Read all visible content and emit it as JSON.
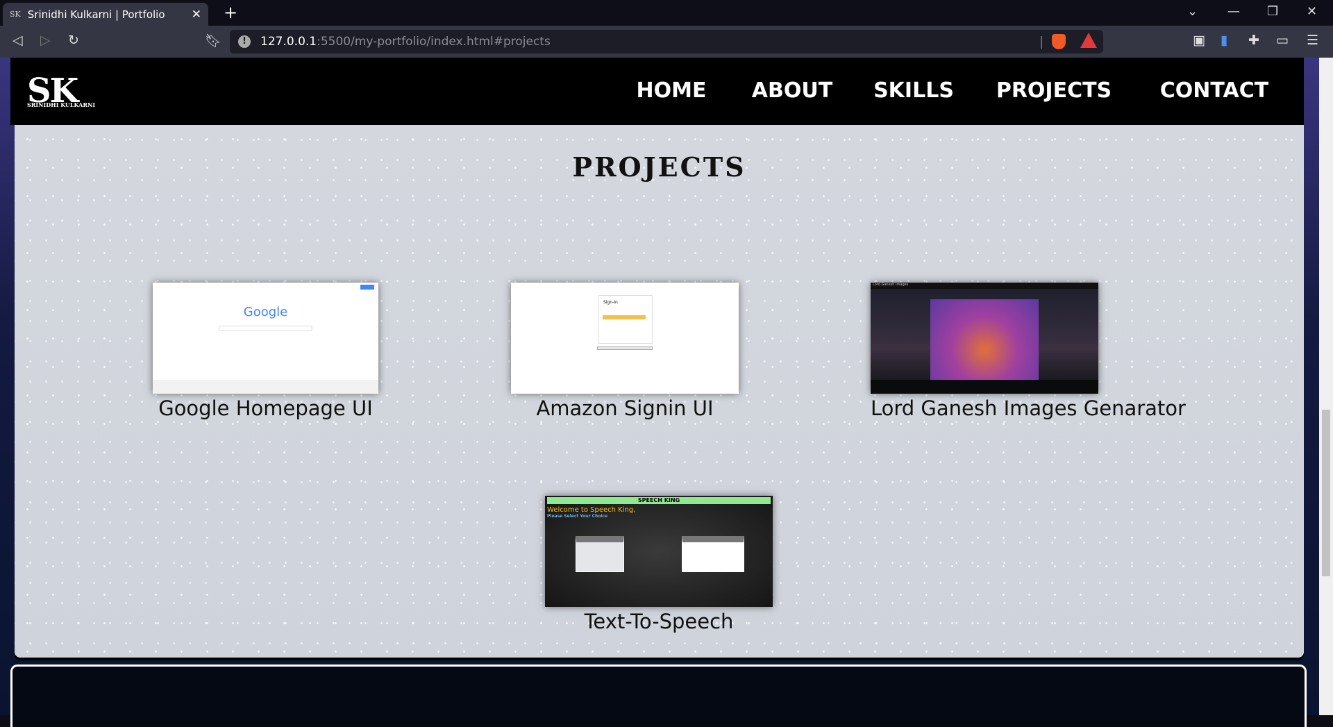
{
  "browser": {
    "tab_title": "Srinidhi Kulkarni | Portfolio",
    "tab_favicon": "SK",
    "url_host": "127.0.0.1",
    "url_rest": ":5500/my-portfolio/index.html#projects"
  },
  "header": {
    "logo": "SK",
    "logo_sub": "SRINIDHI KULKARNI",
    "nav": [
      "HOME",
      "ABOUT",
      "SKILLS",
      "PROJECTS",
      "CONTACT"
    ]
  },
  "projects": {
    "title": "PROJECTS",
    "items": [
      {
        "label": "Google Homepage UI",
        "thumb_text": "Google"
      },
      {
        "label": "Amazon Signin UI",
        "thumb_text": "Sign-In"
      },
      {
        "label": "Lord Ganesh Images Genarator",
        "thumb_text": "Lord Ganesh Images"
      },
      {
        "label": "Text-To-Speech",
        "thumb_text": "SPEECH KING",
        "thumb_welcome": "Welcome to Speech King,",
        "thumb_choice": "Please Select Your Choice"
      }
    ]
  }
}
